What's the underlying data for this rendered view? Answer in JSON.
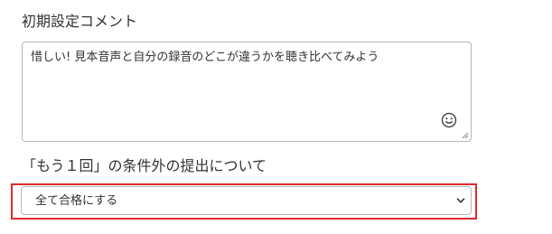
{
  "initial_comment": {
    "title": "初期設定コメント",
    "value": "惜しい! 見本音声と自分の録音のどこが違うかを聴き比べてみよう"
  },
  "retry_condition": {
    "title": "「もう１回」の条件外の提出について",
    "selected": "全て合格にする"
  },
  "icons": {
    "emoji": "smiley-face-icon",
    "dropdown": "chevron-down-icon",
    "resize": "resize-grip-icon"
  },
  "colors": {
    "highlight": "#e02b2b",
    "border": "#b7b7b7"
  }
}
